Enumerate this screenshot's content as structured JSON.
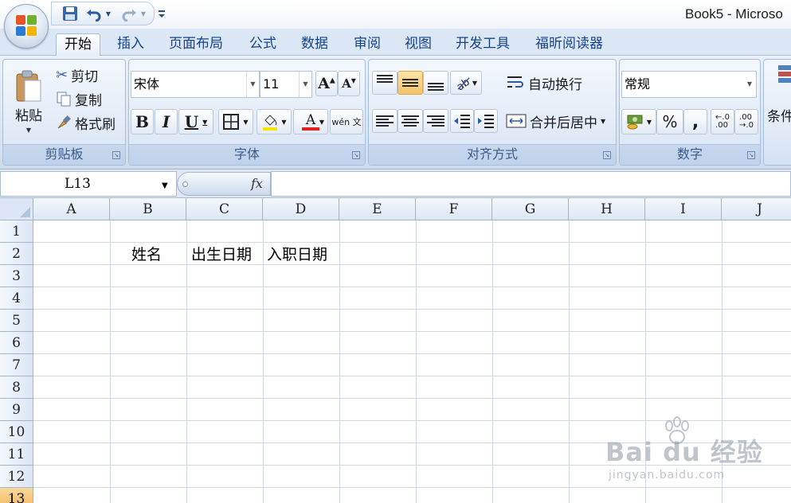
{
  "window": {
    "title": "Book5 - Microso"
  },
  "tabs": [
    {
      "label": "开始",
      "active": true
    },
    {
      "label": "插入"
    },
    {
      "label": "页面布局"
    },
    {
      "label": "公式"
    },
    {
      "label": "数据"
    },
    {
      "label": "审阅"
    },
    {
      "label": "视图"
    },
    {
      "label": "开发工具"
    },
    {
      "label": "福昕阅读器"
    }
  ],
  "clipboard": {
    "paste": "粘贴",
    "cut": "剪切",
    "copy": "复制",
    "format_painter": "格式刷",
    "label": "剪贴板"
  },
  "font": {
    "name": "宋体",
    "size": "11",
    "bold": "B",
    "italic": "I",
    "underline": "U",
    "color_letter": "A",
    "phonetic": "wén 文",
    "label": "字体"
  },
  "alignment": {
    "wrap_text": "自动换行",
    "merge_center": "合并后居中",
    "label": "对齐方式"
  },
  "number": {
    "format": "常规",
    "percent": "%",
    "comma": ",",
    "label": "数字"
  },
  "styles": {
    "partial_label": "条件"
  },
  "formula_bar": {
    "name_box": "L13",
    "fx": "fx"
  },
  "sheet": {
    "columns": [
      "A",
      "B",
      "C",
      "D",
      "E",
      "F",
      "G",
      "H",
      "I",
      "J"
    ],
    "rows": [
      "1",
      "2",
      "3",
      "4",
      "5",
      "6",
      "7",
      "8",
      "9",
      "10",
      "11",
      "12",
      "13"
    ],
    "active_row": "13",
    "cells": {
      "B2": "姓名",
      "C2": "出生日期",
      "D2": "入职日期"
    }
  },
  "watermark": {
    "main": "Bai du 经验",
    "sub": "jingyan.baidu.com"
  },
  "colors": {
    "accent": "#15428b",
    "ribbon": "#dce7f5",
    "highlight": "#f6c26b",
    "font_red": "#e0201a",
    "fill_yellow": "#f2e600"
  }
}
